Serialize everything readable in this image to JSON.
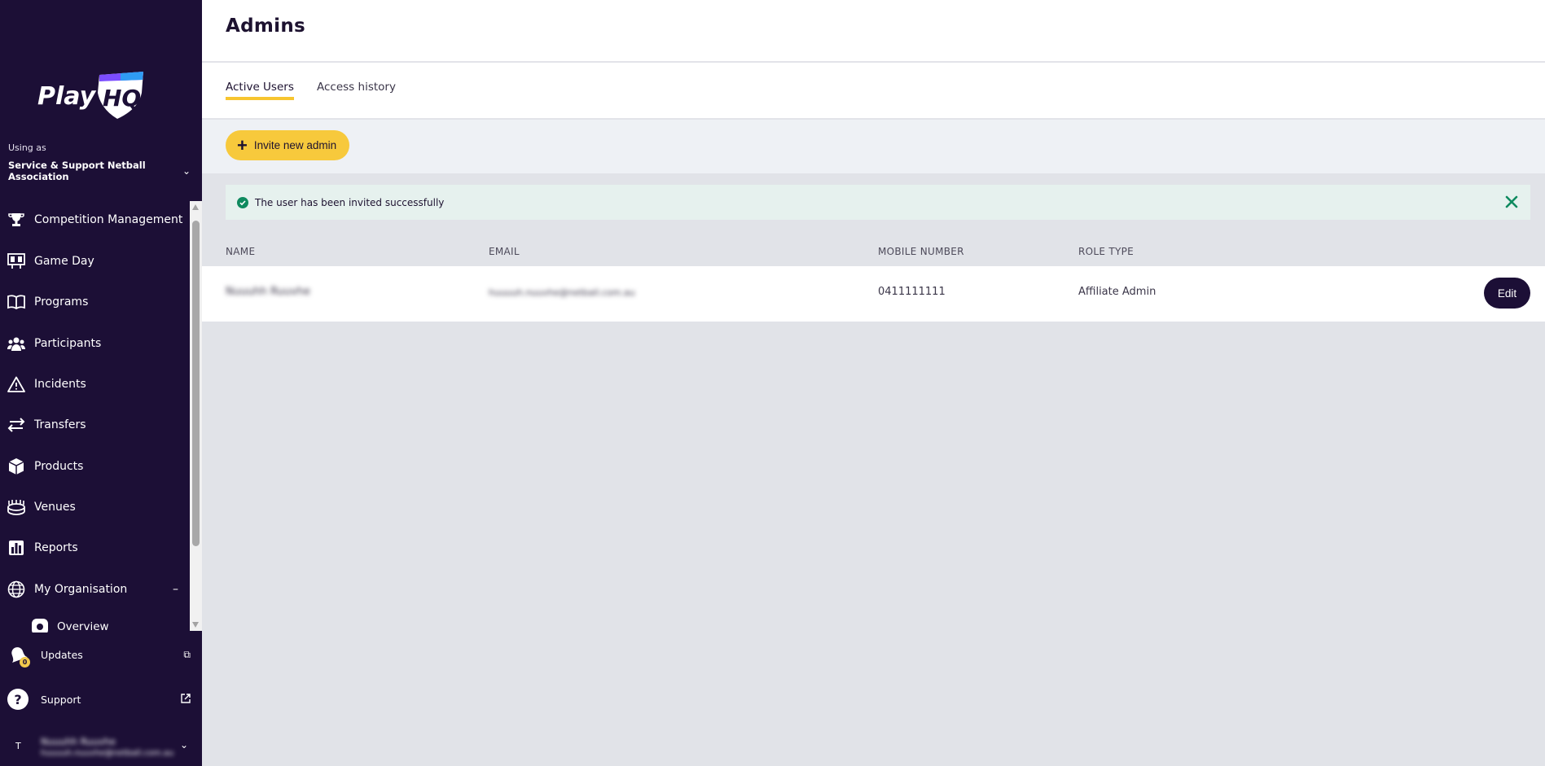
{
  "brand": {
    "logo_text": "PlayHQ",
    "accent": "#f7c93c",
    "sidebar_bg": "#1c0f36"
  },
  "sidebar": {
    "using_as_label": "Using as",
    "org_name": "Service & Support Netball Association",
    "nav": [
      {
        "label": "Competition Management",
        "icon": "trophy-icon"
      },
      {
        "label": "Game Day",
        "icon": "scoreboard-icon"
      },
      {
        "label": "Programs",
        "icon": "book-icon"
      },
      {
        "label": "Participants",
        "icon": "people-icon"
      },
      {
        "label": "Incidents",
        "icon": "warning-icon"
      },
      {
        "label": "Transfers",
        "icon": "transfer-arrows-icon"
      },
      {
        "label": "Products",
        "icon": "box-icon"
      },
      {
        "label": "Venues",
        "icon": "stadium-icon"
      },
      {
        "label": "Reports",
        "icon": "report-chart-icon"
      },
      {
        "label": "My Organisation",
        "icon": "globe-icon",
        "expanded_symbol": "–"
      }
    ],
    "sub_nav": [
      {
        "label": "Overview",
        "icon": "organisation-icon"
      }
    ],
    "updates": {
      "label": "Updates",
      "badge": "0"
    },
    "support": {
      "label": "Support"
    },
    "user": {
      "initial": "T",
      "name": "Nuuuhh Ruuvhe",
      "email": "huuuuh.nuuvhe@netball.com.au"
    }
  },
  "header": {
    "title": "Admins"
  },
  "tabs": [
    {
      "label": "Active Users",
      "active": true
    },
    {
      "label": "Access history",
      "active": false
    }
  ],
  "actions": {
    "invite_label": "Invite new admin"
  },
  "alert": {
    "message": "The user has been invited successfully"
  },
  "table": {
    "headers": [
      "NAME",
      "EMAIL",
      "MOBILE NUMBER",
      "ROLE TYPE"
    ],
    "rows": [
      {
        "name": "Nuuuhh Ruuvhe",
        "email": "huuuuh.nuuvhe@netball.com.au",
        "mobile": "0411111111",
        "role": "Affiliate Admin",
        "action": "Edit"
      }
    ]
  }
}
